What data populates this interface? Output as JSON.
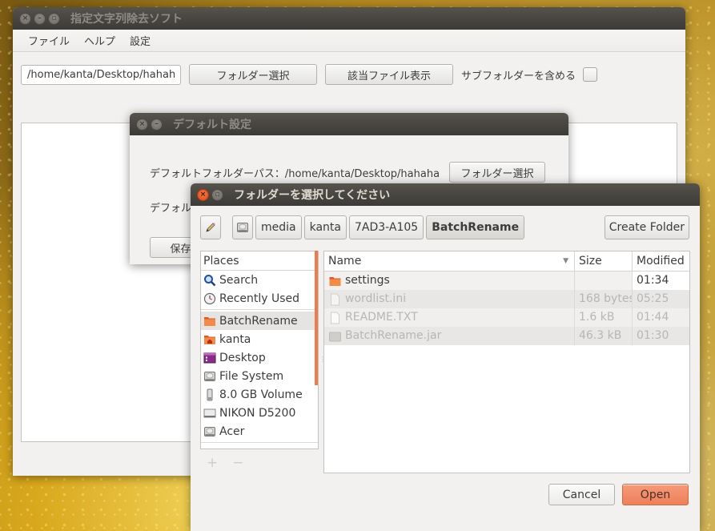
{
  "main_window": {
    "title": "指定文字列除去ソフト",
    "menu": [
      "ファイル",
      "ヘルプ",
      "設定"
    ],
    "path_input_value": "/home/kanta/Desktop/hahaha",
    "select_folder_button": "フォルダー選択",
    "show_files_button": "該当ファイル表示",
    "include_subfolders_label": "サブフォルダーを含める",
    "include_subfolders_checked": false
  },
  "default_settings_dialog": {
    "title": "デフォルト設定",
    "default_path_label": "デフォルトフォルダーパス：/home/kanta/Desktop/hahaha",
    "select_folder_button": "フォルダー選択",
    "second_row_label_partial": "デフォル",
    "save_button_partial": "保存せ"
  },
  "folder_chooser": {
    "title": "フォルダーを選択してください",
    "edit_location_icon": "pencil-icon",
    "path_buttons": [
      {
        "label": "",
        "icon": "drive-icon"
      },
      {
        "label": "media"
      },
      {
        "label": "kanta"
      },
      {
        "label": "7AD3-A105"
      },
      {
        "label": "BatchRename",
        "current": true
      }
    ],
    "create_folder_button": "Create Folder",
    "places_header": "Places",
    "places": [
      {
        "label": "Search",
        "icon": "search-icon"
      },
      {
        "label": "Recently Used",
        "icon": "clock-icon"
      },
      {
        "label": "BatchRename",
        "icon": "folder-icon",
        "selected": true
      },
      {
        "label": "kanta",
        "icon": "home-folder-icon"
      },
      {
        "label": "Desktop",
        "icon": "desktop-icon"
      },
      {
        "label": "File System",
        "icon": "drive-icon"
      },
      {
        "label": "8.0 GB Volume",
        "icon": "usb-drive-icon"
      },
      {
        "label": "NIKON D5200",
        "icon": "removable-drive-icon"
      },
      {
        "label": "Acer",
        "icon": "drive-icon"
      }
    ],
    "places_add": "+",
    "places_remove": "−",
    "columns": {
      "name": "Name",
      "size": "Size",
      "modified": "Modified"
    },
    "files": [
      {
        "name": "settings",
        "size": "",
        "modified": "01:34",
        "type": "folder"
      },
      {
        "name": "wordlist.ini",
        "size": "168 bytes",
        "modified": "05:25",
        "type": "file"
      },
      {
        "name": "README.TXT",
        "size": "1.6 kB",
        "modified": "01:44",
        "type": "file"
      },
      {
        "name": "BatchRename.jar",
        "size": "46.3 kB",
        "modified": "01:30",
        "type": "archive"
      }
    ],
    "cancel_button": "Cancel",
    "open_button": "Open"
  },
  "colors": {
    "accent": "#ef7a4c",
    "titlebar": "#3c3b37",
    "window_bg": "#f2f1f0"
  }
}
